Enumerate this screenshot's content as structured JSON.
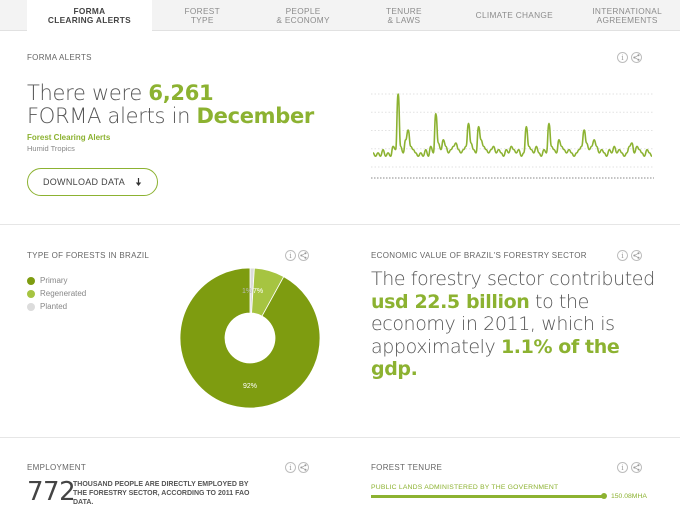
{
  "tabs": [
    {
      "l1": "FORMA",
      "l2": "CLEARING ALERTS",
      "active": true
    },
    {
      "l1": "FOREST",
      "l2": "TYPE"
    },
    {
      "l1": "PEOPLE",
      "l2": "& ECONOMY"
    },
    {
      "l1": "TENURE",
      "l2": "& LAWS"
    },
    {
      "l1": "CLIMATE CHANGE",
      "l2": ""
    },
    {
      "l1": "INTERNATIONAL",
      "l2": "AGREEMENTS"
    }
  ],
  "forma": {
    "title": "FORMA ALERTS",
    "line1_pre": "There were ",
    "count": "6,261",
    "line2_pre": "FORMA alerts in ",
    "month": "December",
    "sub_green": "Forest Clearing Alerts",
    "sub_gray": "Humid Tropics",
    "download": "DOWNLOAD DATA",
    "download_icon": "down-arrow-icon"
  },
  "forest_type": {
    "title": "TYPE OF FORESTS IN BRAZIL",
    "legend": [
      {
        "label": "Primary",
        "color": "#7e9c10"
      },
      {
        "label": "Regenerated",
        "color": "#a6c441"
      },
      {
        "label": "Planted",
        "color": "#dcdcdc"
      }
    ],
    "slice_labels": {
      "primary": "92%",
      "regenerated": "7%",
      "planted": "1%"
    }
  },
  "economy": {
    "title": "ECONOMIC VALUE OF BRAZIL'S FORESTRY SECTOR",
    "t1": "The forestry sector contributed ",
    "h1": "usd 22.5 billion",
    "t2": " to the economy in 2011, which is appoximately ",
    "h2": "1.1% of the gdp."
  },
  "employment": {
    "title": "EMPLOYMENT",
    "value": "772",
    "text": "THOUSAND PEOPLE ARE DIRECTLY EMPLOYED BY THE FORESTRY SECTOR, ACCORDING TO 2011 FAO DATA."
  },
  "tenure": {
    "title": "FOREST TENURE",
    "label": "PUBLIC LANDS ADMINISTERED BY THE GOVERNMENT",
    "value": "150.08MHA"
  },
  "icons": {
    "info": "i",
    "share": "<"
  },
  "chart_data": [
    {
      "type": "line",
      "color": "#8cb231",
      "values": [
        4,
        3,
        4,
        3,
        5,
        3,
        4,
        3,
        6,
        5,
        22,
        6,
        4,
        8,
        11,
        6,
        5,
        4,
        3,
        4,
        3,
        5,
        3,
        6,
        4,
        16,
        7,
        5,
        8,
        6,
        4,
        5,
        6,
        7,
        5,
        4,
        5,
        6,
        13,
        7,
        5,
        4,
        12,
        8,
        6,
        5,
        4,
        5,
        6,
        4,
        5,
        4,
        3,
        5,
        4,
        6,
        5,
        4,
        5,
        3,
        4,
        12,
        6,
        5,
        4,
        6,
        4,
        3,
        5,
        4,
        13,
        6,
        5,
        4,
        8,
        6,
        5,
        4,
        5,
        4,
        3,
        4,
        5,
        6,
        11,
        7,
        5,
        6,
        8,
        6,
        4,
        5,
        4,
        3,
        5,
        4,
        6,
        4,
        5,
        4,
        3,
        4,
        6,
        7,
        4,
        6,
        5,
        4,
        3,
        5,
        4,
        3
      ],
      "grid": true
    },
    {
      "type": "pie",
      "categories": [
        "Primary",
        "Regenerated",
        "Planted"
      ],
      "values": [
        92,
        7,
        1
      ],
      "donut": true
    }
  ]
}
